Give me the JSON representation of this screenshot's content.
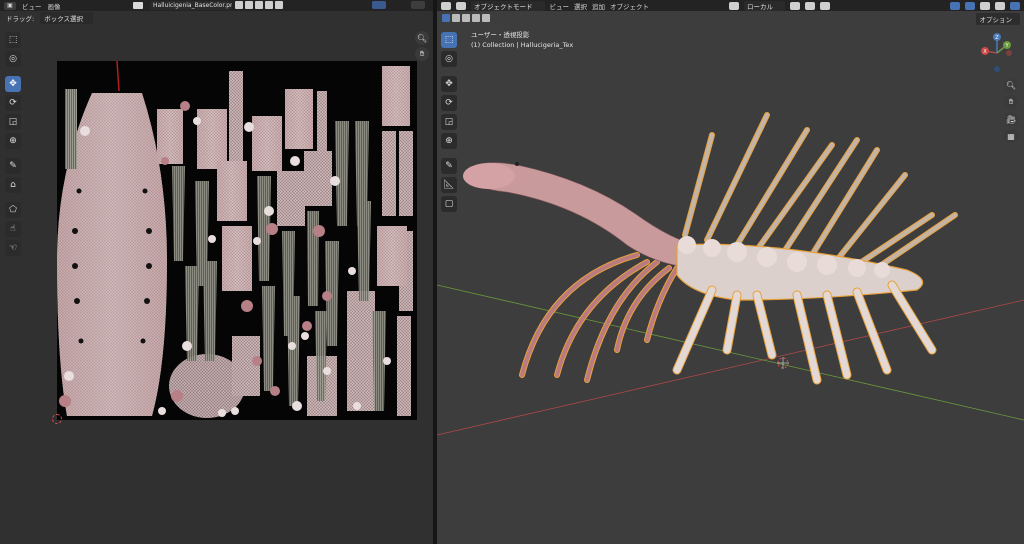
{
  "image_editor": {
    "menus": [
      "ビュー",
      "画像"
    ],
    "image_name": "Halluicigenia_BaseColor.png",
    "drag_label": "ドラッグ:",
    "drag_mode": "ボックス選択"
  },
  "viewport": {
    "mode": "オブジェクトモード",
    "menus": [
      "ビュー",
      "選択",
      "追加",
      "オブジェクト"
    ],
    "orientation": "ローカル",
    "options_label": "オプション",
    "view_name": "ユーザー・透視投影",
    "collection_info": "(1) Collection | Hallucigeria_Tex",
    "gizmo_labels": {
      "x": "X",
      "y": "Y",
      "z": "Z"
    }
  },
  "colors": {
    "accent": "#4772b3",
    "selection_outline": "#e8a13a",
    "x_axis": "#b04848",
    "y_axis": "#6a9a3c"
  }
}
